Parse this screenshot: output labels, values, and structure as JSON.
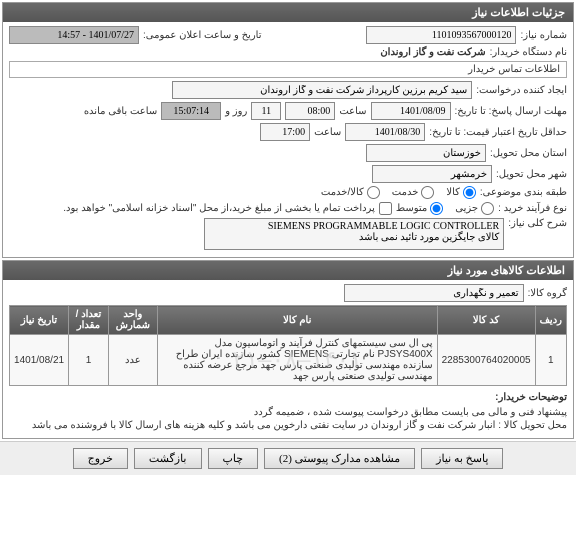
{
  "sections": {
    "need_info_header": "جزئیات اطلاعات نیاز",
    "need_items_header": "اطلاعات کالاهای مورد نیاز"
  },
  "fields": {
    "need_no_label": "شماره نیاز:",
    "need_no": "1101093567000120",
    "announce_label": "تاریخ و ساعت اعلان عمومی:",
    "announce_value": "1401/07/27 - 14:57",
    "buyer_label": "نام دستگاه خریدار:",
    "buyer_value": "شرکت نفت و گاز اروندان",
    "contact_header": "اطلاعات تماس خریدار",
    "requester_label": "ایجاد کننده درخواست:",
    "requester_value": "سید کریم برزین کارپرداز شرکت نفت و گاز اروندان",
    "deadline_label": "مهلت ارسال پاسخ: تا تاریخ:",
    "deadline_date": "1401/08/09",
    "time_label": "ساعت",
    "deadline_time": "08:00",
    "remain_days_label": "روز و",
    "remain_days": "11",
    "remain_time": "15:07:14",
    "remain_suffix": "ساعت باقی مانده",
    "validity_label": "حداقل تاریخ اعتبار قیمت: تا تاریخ:",
    "validity_date": "1401/08/30",
    "validity_time": "17:00",
    "province_label": "استان محل تحویل:",
    "province": "خوزستان",
    "city_label": "شهر محل تحویل:",
    "city": "خرمشهر",
    "category_label": "طبقه بندی موضوعی:",
    "cat_goods": "کالا",
    "cat_service": "خدمت",
    "cat_both": "کالا/خدمت",
    "buy_type_label": "نوع فرآیند خرید :",
    "bt_low": "جزیی",
    "bt_mid": "متوسط",
    "bt_note": "پرداخت تمام یا بخشی از مبلغ خرید،از محل \"اسناد خزانه اسلامی\" خواهد بود.",
    "need_desc_label": "شرح کلی نیاز:",
    "need_desc": "SIEMENS PROGRAMMABLE LOGIC CONTROLLER\nکالای جایگزین مورد تائید نمی باشد",
    "goods_group_label": "گروه کالا:",
    "goods_group": "تعمیر و نگهداری"
  },
  "table": {
    "headers": {
      "row": "ردیف",
      "code": "کد کالا",
      "name": "نام کالا",
      "unit": "واحد شمارش",
      "qty": "تعداد / مقدار",
      "date": "تاریخ نیاز"
    },
    "rows": [
      {
        "row": "1",
        "code": "2285300764020005",
        "name": "پی ال سی سیستمهای کنترل فرآیند و اتوماسیون مدل PJSYS400X نام تجارتی SIEMENS کشور سازنده ایران طراح سازنده مهندسی تولیدی صنعتی پارس جهد مرجع عرضه کننده مهندسی تولیدی صنعتی پارس جهد",
        "unit": "عدد",
        "qty": "1",
        "date": "1401/08/21"
      }
    ],
    "watermark": "۱۴۰۱–۰۸–۲۱"
  },
  "buyer_notes": {
    "label": "توضیحات خریدار:",
    "line1": "پیشنهاد فنی و مالی می بایست مطابق درخواست پیوست شده ، ضمیمه گردد",
    "line2": "محل تحویل کالا : انبار شرکت نفت و گاز اروندان در سایت نفتی دارخوین می باشد و کلیه هزینه های ارسال کالا با فروشنده می باشد"
  },
  "buttons": {
    "reply": "پاسخ به نیاز",
    "attach": "مشاهده مدارک پیوستی (2)",
    "print": "چاپ",
    "back": "بازگشت",
    "exit": "خروج"
  }
}
